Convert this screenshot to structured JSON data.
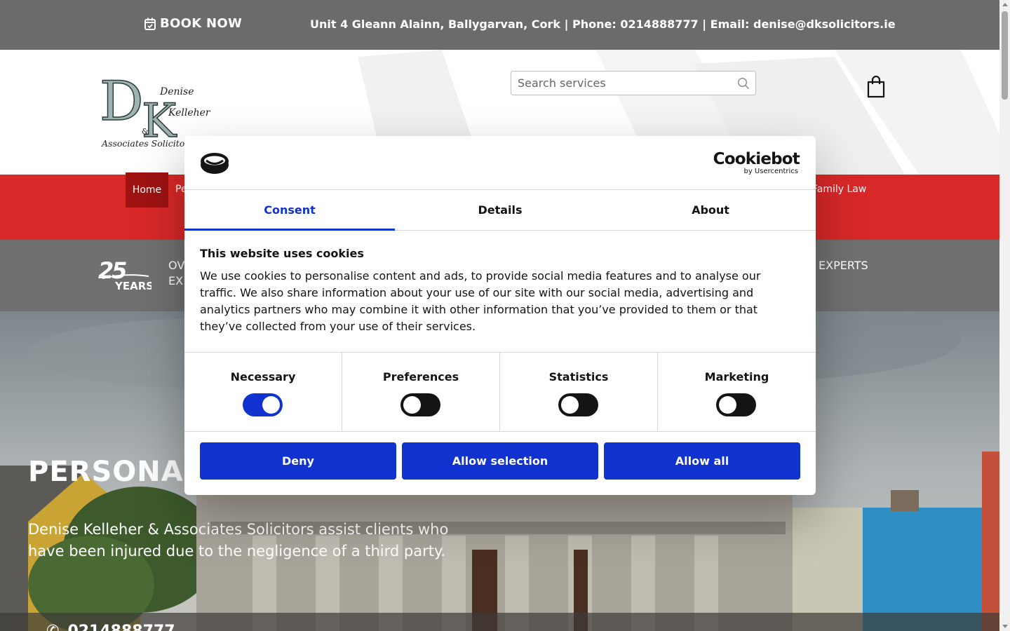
{
  "topbar": {
    "book_now": "BOOK NOW",
    "contact_line": "Unit 4 Gleann Alainn, Ballygarvan, Cork | Phone: 0214888777 | Email: denise@dksolicitors.ie"
  },
  "header": {
    "logo_text": [
      "Denise",
      "Kelleher",
      "&",
      "Associates Solicitors"
    ],
    "search_placeholder": "Search services"
  },
  "nav": {
    "home": "Home",
    "partial_left": "Pe",
    "partial_right": "Family Law"
  },
  "band": {
    "badge_number": "25",
    "badge_word": "YEARS",
    "text_line1": "OV",
    "text_line2": "EX",
    "text_right": "EXPERTS"
  },
  "hero": {
    "title": "PERSONAL",
    "description": "Denise Kelleher & Associates Solicitors assist clients who have been injured due to the negligence of a third party.",
    "phone": "0214888777"
  },
  "cookie_dialog": {
    "brand_name": "Cookiebot",
    "brand_sub": "by Usercentrics",
    "tabs": [
      {
        "label": "Consent",
        "active": true
      },
      {
        "label": "Details",
        "active": false
      },
      {
        "label": "About",
        "active": false
      }
    ],
    "title": "This website uses cookies",
    "text": "We use cookies to personalise content and ads, to provide social media features and to analyse our traffic. We also share information about your use of our site with our social media, advertising and analytics partners who may combine it with other information that you’ve provided to them or that they’ve collected from your use of their services.",
    "categories": [
      {
        "label": "Necessary",
        "enabled": true
      },
      {
        "label": "Preferences",
        "enabled": false
      },
      {
        "label": "Statistics",
        "enabled": false
      },
      {
        "label": "Marketing",
        "enabled": false
      }
    ],
    "buttons": {
      "deny": "Deny",
      "allow_selection": "Allow selection",
      "allow_all": "Allow all"
    }
  },
  "colors": {
    "topbar_bg": "#6b6b6b",
    "nav_red": "#d92828",
    "nav_active": "#9e1212",
    "band_grey": "#707070",
    "cookie_blue": "#1032cf"
  }
}
